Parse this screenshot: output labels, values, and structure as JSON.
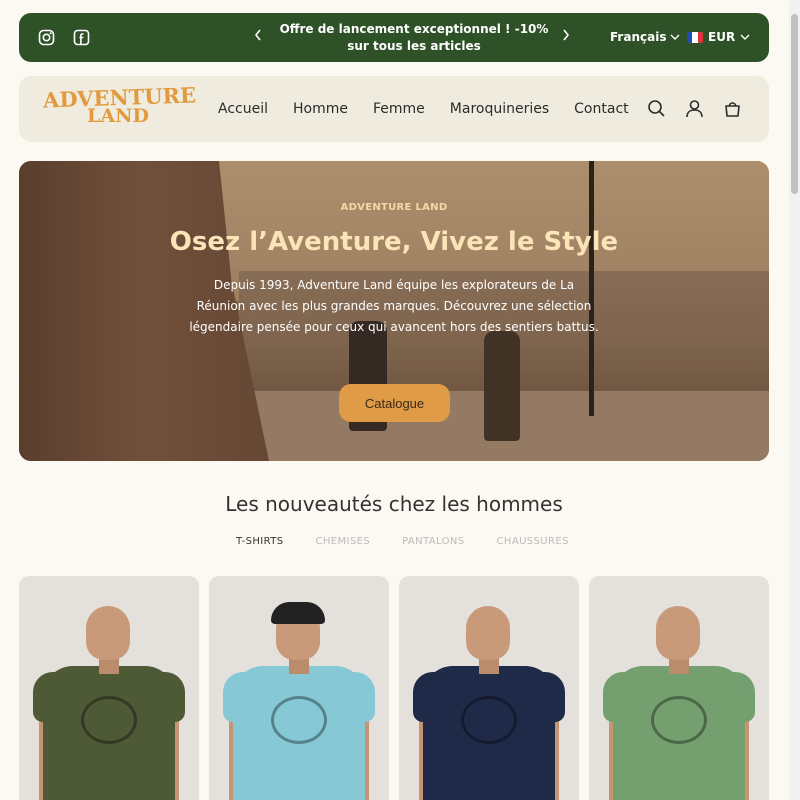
{
  "announcement": {
    "message": "Offre de lancement exceptionnel ! -10% sur tous les articles",
    "prev_icon": "chevron-left-icon",
    "next_icon": "chevron-right-icon",
    "language": "Français",
    "currency": "EUR",
    "social": [
      "instagram-icon",
      "facebook-icon"
    ],
    "bg_color": "#2f5128"
  },
  "header": {
    "logo_line1": "ADVENTURE",
    "logo_line2": "LAND",
    "nav": [
      "Accueil",
      "Homme",
      "Femme",
      "Maroquineries",
      "Contact"
    ],
    "icons": [
      "search-icon",
      "account-icon",
      "cart-icon"
    ]
  },
  "hero": {
    "eyebrow": "ADVENTURE LAND",
    "title": "Osez l’Aventure, Vivez le Style",
    "description": "Depuis 1993, Adventure Land équipe les explorateurs de La Réunion avec les plus grandes marques. Découvrez une sélection légendaire pensée pour ceux qui avancent hors des sentiers battus.",
    "cta": "Catalogue",
    "cta_color": "#e09b46"
  },
  "section": {
    "title": "Les nouveautés chez les hommes",
    "tabs": [
      "T-SHIRTS",
      "CHEMISES",
      "PANTALONS",
      "CHAUSSURES"
    ],
    "active_tab": "T-SHIRTS"
  },
  "products": [
    {
      "shirt_color": "#4e5a36",
      "cap": false
    },
    {
      "shirt_color": "#86c8d6",
      "cap": true
    },
    {
      "shirt_color": "#1f2a48",
      "cap": false
    },
    {
      "shirt_color": "#74a070",
      "cap": false
    }
  ]
}
